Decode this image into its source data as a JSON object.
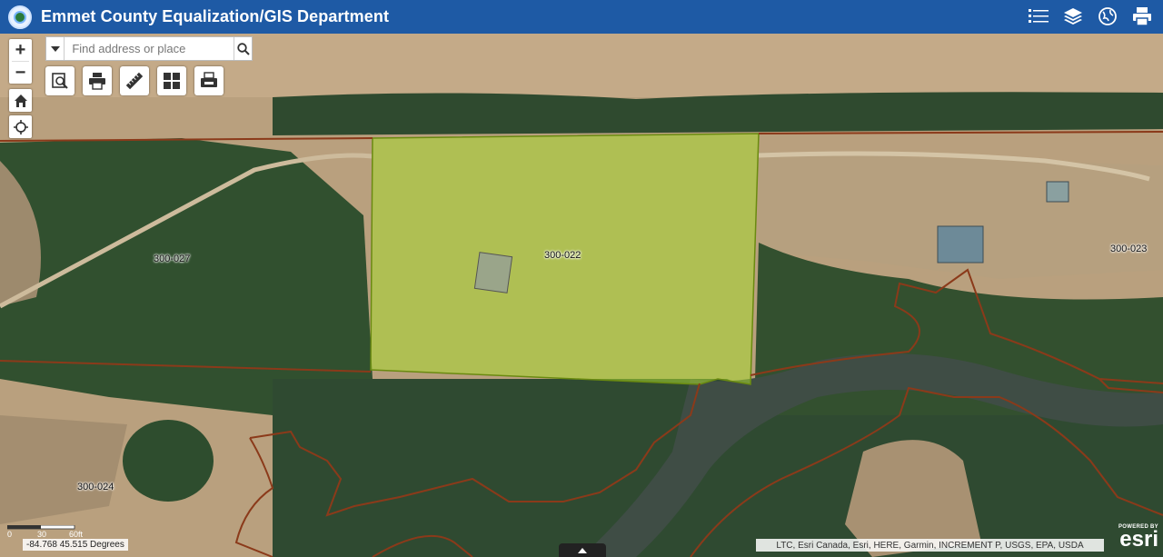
{
  "header": {
    "title": "Emmet County Equalization/GIS Department",
    "tools": [
      "list-icon",
      "layers-icon",
      "basemap-gallery-icon",
      "print-icon"
    ]
  },
  "search": {
    "placeholder": "Find address or place",
    "value": ""
  },
  "zoom": {
    "in_label": "+",
    "out_label": "−"
  },
  "toolbar": [
    "identify-icon",
    "print-icon",
    "measure-icon",
    "grid-icon",
    "print-export-icon"
  ],
  "parcels": {
    "selected": "300-022",
    "labels": [
      "300-027",
      "300-022",
      "300-023",
      "300-024"
    ]
  },
  "colors": {
    "header": "#1e5aa5",
    "parcel_line": "#8b3a1a",
    "selection_fill": "#a8d830"
  },
  "scale": {
    "labels": [
      "0",
      "30",
      "60ft"
    ]
  },
  "coordinates": "-84.768 45.515 Degrees",
  "attribution": "LTC, Esri Canada, Esri, HERE, Garmin, INCREMENT P, USGS, EPA, USDA",
  "esri": {
    "powered": "POWERED BY",
    "word": "esri"
  }
}
